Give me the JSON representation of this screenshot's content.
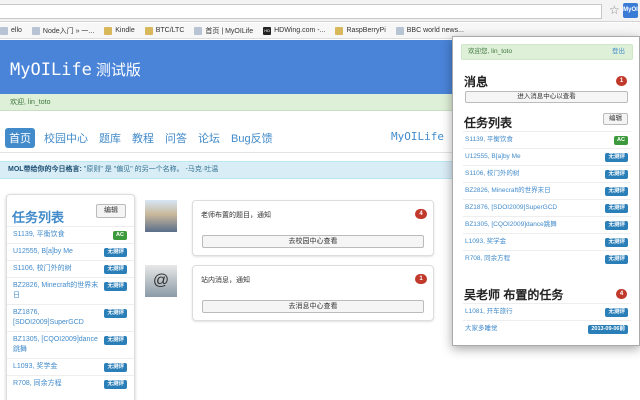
{
  "browser": {
    "extension_label": "MyOI",
    "bookmarks": [
      {
        "label": "ello",
        "icon": "page-icon"
      },
      {
        "label": "Node入门 » 一...",
        "icon": "page-icon"
      },
      {
        "label": "Kindle",
        "icon": "folder-icon"
      },
      {
        "label": "BTC/LTC",
        "icon": "folder-icon"
      },
      {
        "label": "首页 | MyOILife",
        "icon": "page-icon"
      },
      {
        "label": "HDWing.com -...",
        "icon": "hd-icon"
      },
      {
        "label": "RaspBerryPi",
        "icon": "folder-icon"
      },
      {
        "label": "BBC world news...",
        "icon": "page-icon"
      }
    ]
  },
  "site": {
    "title": "MyOILife",
    "subtitle": "测试版",
    "welcome": "欢迎, lin_toto",
    "brand": "MyOILife",
    "colors": {
      "header": "#4a84d8",
      "link": "#428bca",
      "danger": "#c0392b",
      "success": "#3c9a3c"
    }
  },
  "nav": {
    "items": [
      "首页",
      "校园中心",
      "题库",
      "教程",
      "问答",
      "论坛",
      "Bug反馈"
    ],
    "active": "首页"
  },
  "quote": {
    "prefix": "MOL带给你的今日格言:",
    "text": "\"原则\" 是 \"偏见\" 的另一个名称。 -马克·吐温"
  },
  "task_panel": {
    "title": "任务列表",
    "edit_label": "编辑",
    "tasks": [
      {
        "title": "S1139, 平衡饮食",
        "badge": "AC",
        "kind": "ac"
      },
      {
        "title": "U12555, B[a]by Me",
        "badge": "无测评",
        "kind": "none"
      },
      {
        "title": "S1106, 校门外的树",
        "badge": "无测评",
        "kind": "none"
      },
      {
        "title": "BZ2826, Minecraft的世界末日",
        "badge": "无测评",
        "kind": "none"
      },
      {
        "title": "BZ1876, [SDOI2009]SuperGCD",
        "badge": "无测评",
        "kind": "none"
      },
      {
        "title": "BZ1305, [CQOI2009]dance跳舞",
        "badge": "无测评",
        "kind": "none"
      },
      {
        "title": "L1093, 奖学金",
        "badge": "无测评",
        "kind": "none"
      },
      {
        "title": "R708, 同余方程",
        "badge": "无测评",
        "kind": "none"
      }
    ]
  },
  "messages": [
    {
      "text": "老师布置的题目，通知",
      "count": "4",
      "button": "去校园中心查看",
      "avatar": "landscape-avatar"
    },
    {
      "text": "站内消息，通知",
      "count": "1",
      "button": "去消息中心查看",
      "avatar": "at-sign-avatar"
    }
  ],
  "popup": {
    "welcome": "欢迎您, lin_toto",
    "logout": "登出",
    "messages_title": "消息",
    "messages_count": "1",
    "messages_button": "进入消息中心以查看",
    "tasks_title": "任务列表",
    "tasks_edit": "编辑",
    "tasks": [
      {
        "title": "S1139, 平衡饮食",
        "badge": "AC",
        "kind": "ac"
      },
      {
        "title": "U12555, B[a]by Me",
        "badge": "无测评",
        "kind": "none"
      },
      {
        "title": "S1106, 校门外的树",
        "badge": "无测评",
        "kind": "none"
      },
      {
        "title": "BZ2826, Minecraft的世界末日",
        "badge": "无测评",
        "kind": "none"
      },
      {
        "title": "BZ1876, [SDOI2009]SuperGCD",
        "badge": "无测评",
        "kind": "none"
      },
      {
        "title": "BZ1305, [CQOI2009]dance跳舞",
        "badge": "无测评",
        "kind": "none"
      },
      {
        "title": "L1093, 奖学金",
        "badge": "无测评",
        "kind": "none"
      },
      {
        "title": "R708, 同余方程",
        "badge": "无测评",
        "kind": "none"
      }
    ],
    "teacher_title": "吴老师 布置的任务",
    "teacher_count": "4",
    "teacher_tasks": [
      {
        "title": "L1081, 开车旅行",
        "badge": "无测评",
        "kind": "none"
      },
      {
        "title": "大家多睡觉",
        "badge": "2013-09-06前",
        "kind": "date"
      }
    ]
  }
}
